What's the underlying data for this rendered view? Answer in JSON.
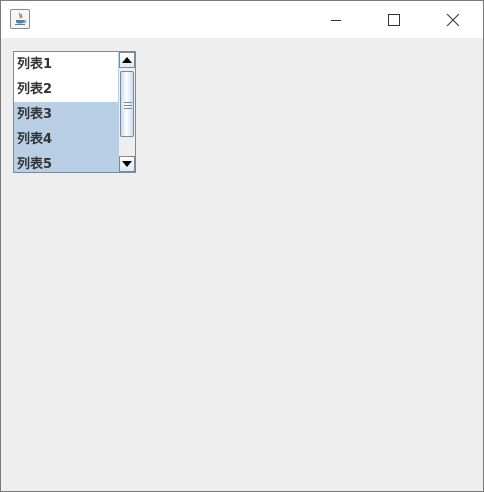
{
  "window": {
    "title": "",
    "controls": [
      "minimize",
      "maximize",
      "close"
    ]
  },
  "colors": {
    "selection": "#b8cfe5",
    "client_bg": "#eeeeee",
    "text": "#333333"
  },
  "list": {
    "items": [
      {
        "label": "列表1",
        "selected": false
      },
      {
        "label": "列表2",
        "selected": false
      },
      {
        "label": "列表3",
        "selected": true
      },
      {
        "label": "列表4",
        "selected": true
      },
      {
        "label": "列表5",
        "selected": true
      }
    ]
  }
}
